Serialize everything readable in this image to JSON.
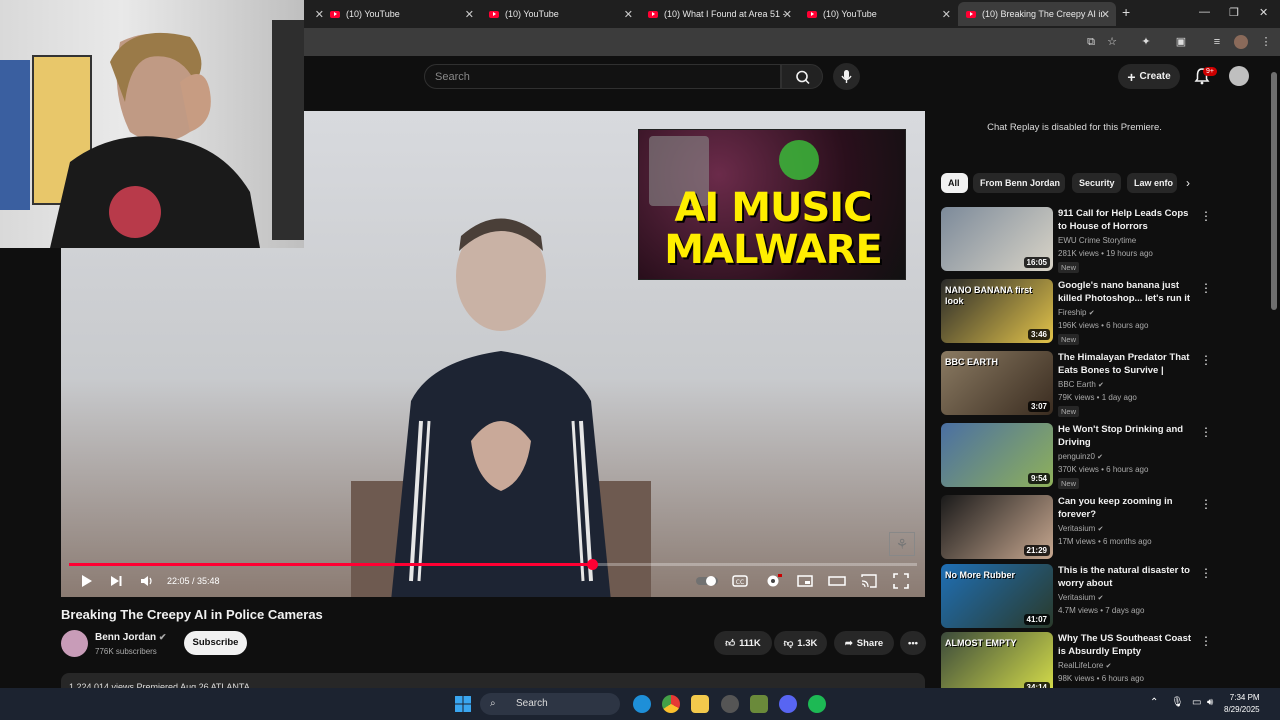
{
  "browser": {
    "tabs": [
      {
        "title": "(10) YouTube",
        "active": false
      },
      {
        "title": "(10) YouTube",
        "active": false
      },
      {
        "title": "(10) What I Found at Area 51 - ",
        "active": false
      },
      {
        "title": "(10) YouTube",
        "active": false
      },
      {
        "title": "(10) Breaking The Creepy AI in ",
        "active": true
      }
    ],
    "new_tab_label": "+"
  },
  "header": {
    "search_placeholder": "Search",
    "create_label": "Create",
    "notification_badge": "9+"
  },
  "player": {
    "thumbnail_overlay_lines": [
      "AI MUSIC",
      "MALWARE"
    ],
    "time_current": "22:05",
    "time_total": "35:48",
    "time_display": "22:05 / 35:48",
    "progress_fraction": 0.617
  },
  "video": {
    "title": "Breaking The Creepy AI in Police Cameras",
    "channel_name": "Benn Jordan",
    "channel_subs": "776K subscribers",
    "subscribe_label": "Subscribe",
    "likes": "111K",
    "dislikes": "1.3K",
    "share_label": "Share",
    "description_preview": "1,224,014 views  Premiered Aug 26  ATLANTA"
  },
  "sidebar": {
    "chat_replay_text": "Chat Replay is disabled for this Premiere.",
    "chips": [
      "All",
      "From Benn Jordan",
      "Security",
      "Law enfo"
    ],
    "recommendations": [
      {
        "title": "911 Call for Help Leads Cops to House of Horrors",
        "channel": "EWU Crime Storytime",
        "meta": "281K views • 19 hours ago",
        "badge": "New",
        "duration": "16:05",
        "verified": false,
        "colors": [
          "#7c8a9a",
          "#d9d4c7"
        ]
      },
      {
        "title": "Google's nano banana just killed Photoshop... let's run it",
        "channel": "Fireship",
        "meta": "196K views • 6 hours ago",
        "badge": "New",
        "duration": "3:46",
        "verified": true,
        "thumb_text": "NANO BANANA first look",
        "colors": [
          "#2a2a2a",
          "#e3c44a"
        ]
      },
      {
        "title": "The Himalayan Predator That Eats Bones to Survive | Hidden...",
        "channel": "BBC Earth",
        "meta": "79K views • 1 day ago",
        "badge": "New",
        "duration": "3:07",
        "verified": true,
        "thumb_text": "BBC EARTH",
        "colors": [
          "#8a7a62",
          "#3a2c20"
        ]
      },
      {
        "title": "He Won't Stop Drinking and Driving",
        "channel": "penguinz0",
        "meta": "370K views • 6 hours ago",
        "badge": "New",
        "duration": "9:54",
        "verified": true,
        "colors": [
          "#4a6fa3",
          "#8fb15a"
        ]
      },
      {
        "title": "Can you keep zooming in forever?",
        "channel": "Veritasium",
        "meta": "17M views • 6 months ago",
        "badge": "",
        "duration": "21:29",
        "verified": true,
        "colors": [
          "#1a1a1a",
          "#c8a890"
        ]
      },
      {
        "title": "This is the natural disaster to worry about",
        "channel": "Veritasium",
        "meta": "4.7M views • 7 days ago",
        "badge": "",
        "duration": "41:07",
        "verified": true,
        "thumb_text": "No More Rubber",
        "colors": [
          "#1f6fb5",
          "#2a3a2a"
        ]
      },
      {
        "title": "Why The US Southeast Coast is Absurdly Empty",
        "channel": "RealLifeLore",
        "meta": "98K views • 6 hours ago",
        "badge": "",
        "duration": "34:14",
        "verified": true,
        "thumb_text": "ALMOST EMPTY",
        "colors": [
          "#3b4a3b",
          "#d8e04a"
        ]
      }
    ]
  },
  "taskbar": {
    "search_label": "Search",
    "time": "7:34 PM",
    "date": "8/29/2025"
  },
  "colors": {
    "accent_red": "#ff0033",
    "background": "#0f0f0f",
    "surface": "#272727"
  }
}
